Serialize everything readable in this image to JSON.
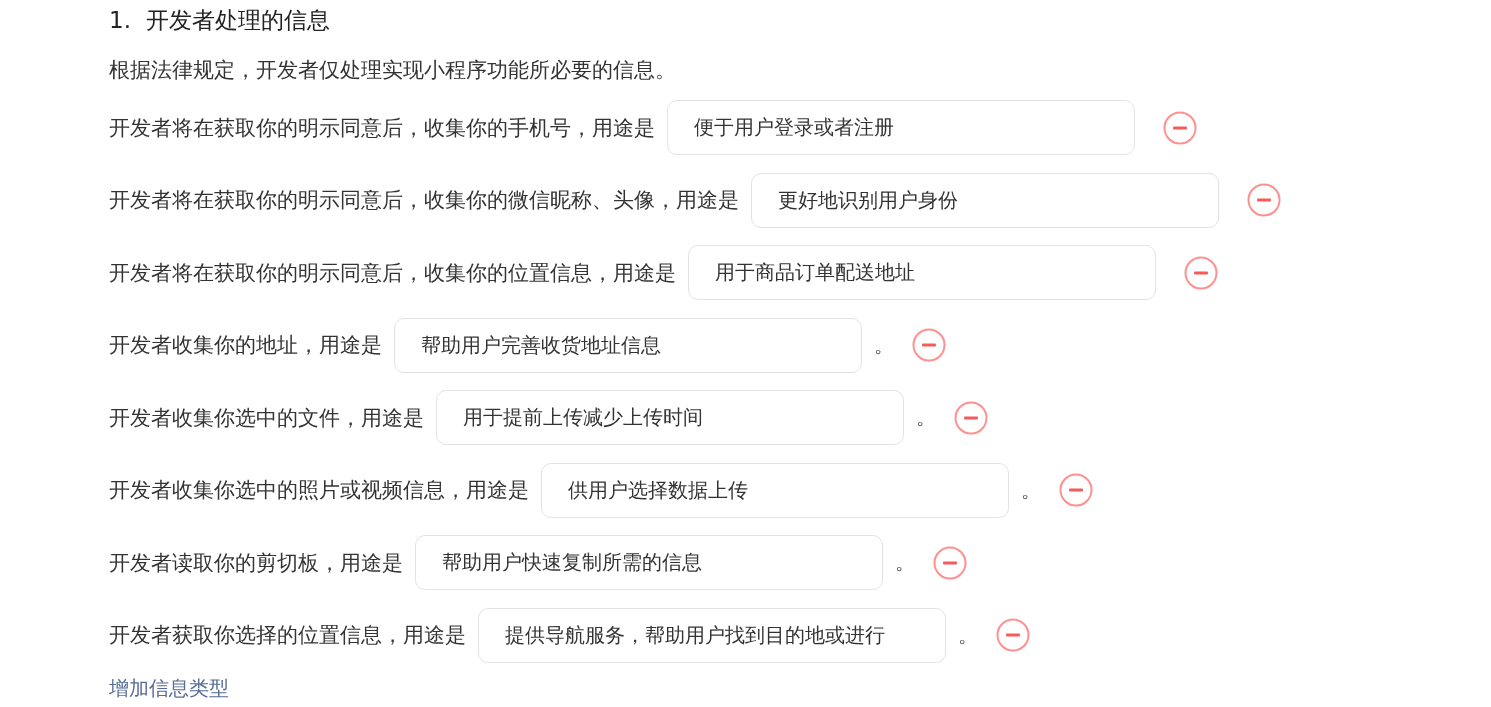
{
  "section_title": "1.  开发者处理的信息",
  "intro": "根据法律规定，开发者仅处理实现小程序功能所必要的信息。",
  "items": [
    {
      "label": "开发者将在获取你的明示同意后，收集你的手机号，用途是",
      "purpose": "便于用户登录或者注册"
    },
    {
      "label": "开发者将在获取你的明示同意后，收集你的微信昵称、头像，用途是",
      "purpose": "更好地识别用户身份"
    },
    {
      "label": "开发者将在获取你的明示同意后，收集你的位置信息，用途是",
      "purpose": "用于商品订单配送地址"
    },
    {
      "label": "开发者收集你的地址，用途是",
      "purpose": "帮助用户完善收货地址信息",
      "suffix": "。"
    },
    {
      "label": "开发者收集你选中的文件，用途是",
      "purpose": "用于提前上传减少上传时间",
      "suffix": "。"
    },
    {
      "label": "开发者收集你选中的照片或视频信息，用途是",
      "purpose": "供用户选择数据上传",
      "suffix": "。"
    },
    {
      "label": "开发者读取你的剪切板，用途是",
      "purpose": "帮助用户快速复制所需的信息",
      "suffix": "。"
    },
    {
      "label": "开发者获取你选择的位置信息，用途是",
      "purpose": "提供导航服务，帮助用户找到目的地或进行",
      "suffix": "。"
    }
  ],
  "add_link": "增加信息类型"
}
